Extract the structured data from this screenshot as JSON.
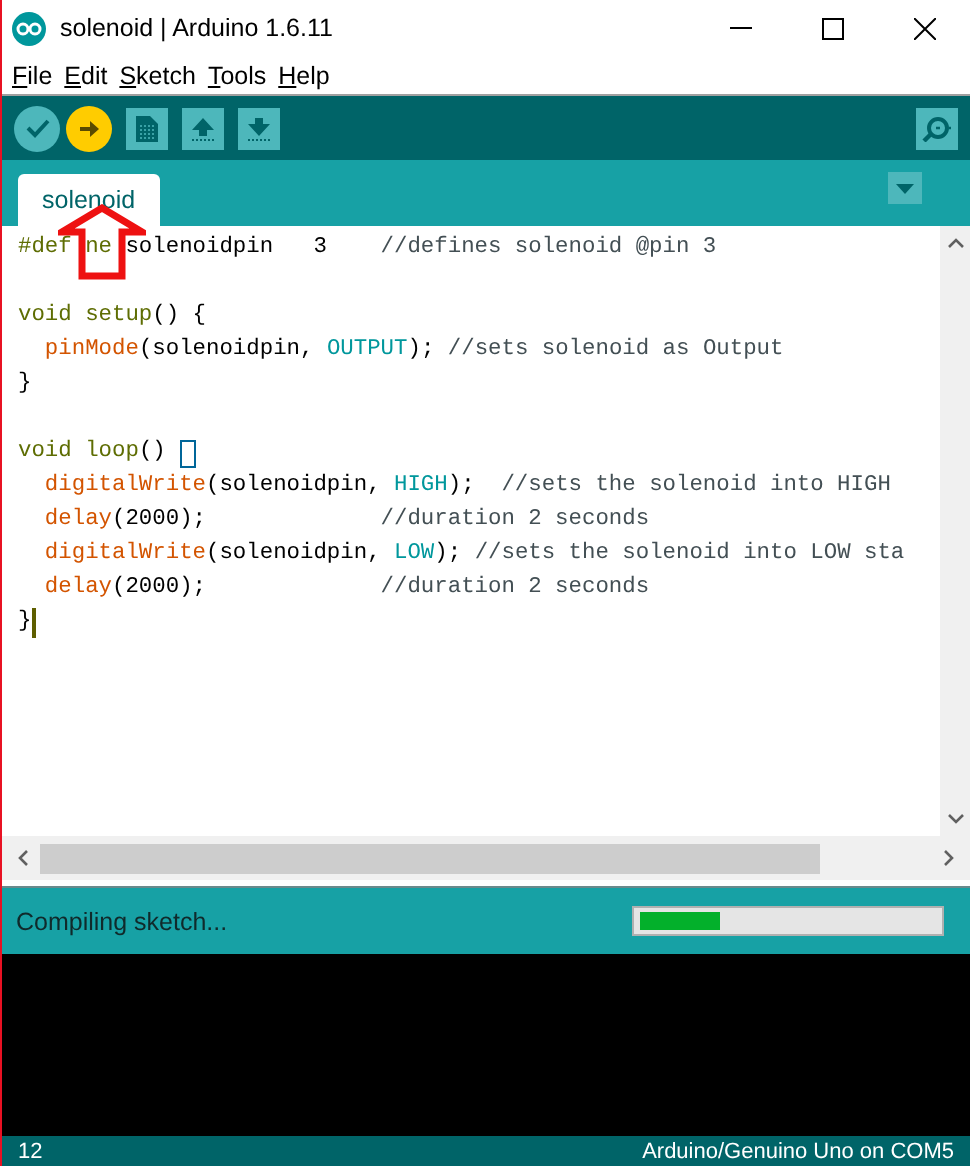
{
  "window": {
    "title": "solenoid | Arduino 1.6.11"
  },
  "menu": [
    "File",
    "Edit",
    "Sketch",
    "Tools",
    "Help"
  ],
  "toolbar": {
    "buttons": [
      {
        "kind": "verify",
        "selected": false
      },
      {
        "kind": "upload",
        "selected": true
      },
      {
        "kind": "new",
        "selected": false
      },
      {
        "kind": "open",
        "selected": false
      },
      {
        "kind": "save",
        "selected": false
      },
      {
        "kind": "serial-monitor",
        "selected": false
      }
    ]
  },
  "tabs": [
    {
      "label": "solenoid",
      "selected": true
    }
  ],
  "editor": {
    "lines": [
      {
        "kind": "code",
        "tokens": [
          {
            "kind": "keyword",
            "text": "#def"
          },
          {
            "kind": "keyword",
            "text": "ne",
            "gap_before": true
          },
          {
            "kind": "plain",
            "text": " solenoidpin   3    "
          },
          {
            "kind": "comment",
            "text": "//defines solenoid @pin 3"
          }
        ]
      },
      {
        "kind": "blank"
      },
      {
        "kind": "code",
        "tokens": [
          {
            "kind": "keyword",
            "text": "void setup"
          },
          {
            "kind": "plain",
            "text": "() {"
          }
        ]
      },
      {
        "kind": "code",
        "tokens": [
          {
            "kind": "function",
            "text": "  pinMode"
          },
          {
            "kind": "plain",
            "text": "(solenoidpin, "
          },
          {
            "kind": "constant",
            "text": "OUTPUT"
          },
          {
            "kind": "plain",
            "text": "); "
          },
          {
            "kind": "comment",
            "text": "//sets solenoid as Output"
          }
        ]
      },
      {
        "kind": "code",
        "tokens": [
          {
            "kind": "plain",
            "text": "}"
          }
        ]
      },
      {
        "kind": "blank"
      },
      {
        "kind": "code",
        "tokens": [
          {
            "kind": "keyword",
            "text": "void loop"
          },
          {
            "kind": "plain",
            "text": "() "
          },
          {
            "kind": "bracket-box"
          }
        ]
      },
      {
        "kind": "code",
        "tokens": [
          {
            "kind": "function",
            "text": "  digitalWrite"
          },
          {
            "kind": "plain",
            "text": "(solenoidpin, "
          },
          {
            "kind": "constant",
            "text": "HIGH"
          },
          {
            "kind": "plain",
            "text": ");  "
          },
          {
            "kind": "comment",
            "text": "//sets the solenoid into HIGH"
          }
        ]
      },
      {
        "kind": "code",
        "tokens": [
          {
            "kind": "function",
            "text": "  delay"
          },
          {
            "kind": "plain",
            "text": "(2000);             "
          },
          {
            "kind": "comment",
            "text": "//duration 2 seconds"
          }
        ]
      },
      {
        "kind": "code",
        "tokens": [
          {
            "kind": "function",
            "text": "  digitalWrite"
          },
          {
            "kind": "plain",
            "text": "(solenoidpin, "
          },
          {
            "kind": "constant",
            "text": "LOW"
          },
          {
            "kind": "plain",
            "text": "); "
          },
          {
            "kind": "comment",
            "text": "//sets the solenoid into LOW sta"
          }
        ]
      },
      {
        "kind": "code",
        "tokens": [
          {
            "kind": "function",
            "text": "  delay"
          },
          {
            "kind": "plain",
            "text": "(2000);             "
          },
          {
            "kind": "comment",
            "text": "//duration 2 seconds"
          }
        ]
      },
      {
        "kind": "code",
        "tokens": [
          {
            "kind": "plain",
            "text": "}"
          },
          {
            "kind": "caret"
          }
        ]
      }
    ]
  },
  "status": {
    "message": "Compiling sketch...",
    "progress": {
      "level": 0.27
    }
  },
  "footer": {
    "line": "12",
    "board": "Arduino/Genuino Uno on COM5"
  },
  "annotation": {
    "kind": "arrow"
  }
}
